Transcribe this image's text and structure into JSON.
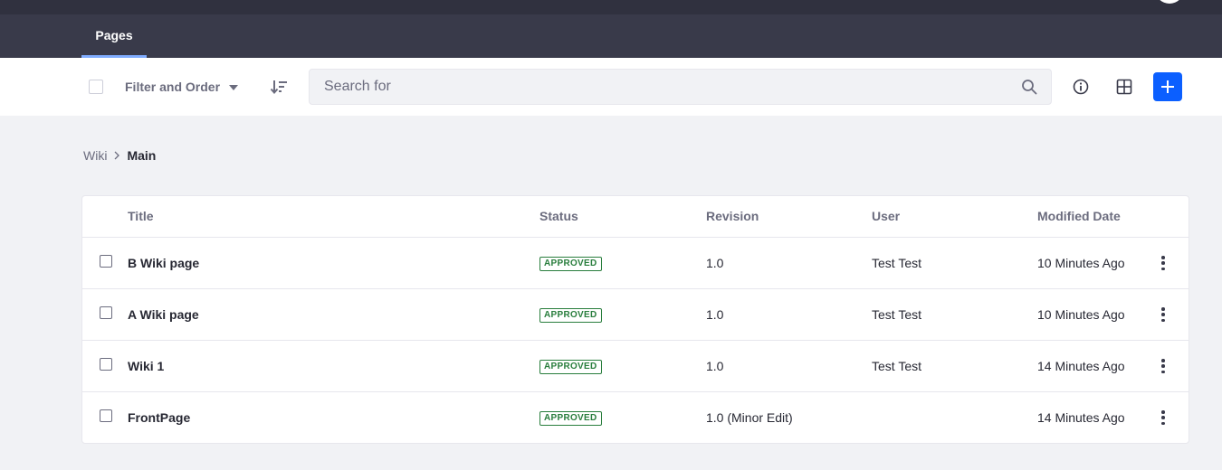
{
  "nav": {
    "tab_label": "Pages"
  },
  "toolbar": {
    "filter_label": "Filter and Order",
    "search_placeholder": "Search for",
    "icons": {
      "order": "sort-order-icon",
      "search": "search-icon",
      "info": "info-icon",
      "view": "grid-view-icon",
      "add": "plus-icon"
    },
    "add_button_color": "#0b5fff"
  },
  "breadcrumb": {
    "parent": "Wiki",
    "current": "Main"
  },
  "table": {
    "columns": {
      "title": "Title",
      "status": "Status",
      "revision": "Revision",
      "user": "User",
      "modified": "Modified Date"
    },
    "rows": [
      {
        "title": "B Wiki page",
        "status": "APPROVED",
        "revision": "1.0",
        "user": "Test Test",
        "modified": "10 Minutes Ago"
      },
      {
        "title": "A Wiki page",
        "status": "APPROVED",
        "revision": "1.0",
        "user": "Test Test",
        "modified": "10 Minutes Ago"
      },
      {
        "title": "Wiki 1",
        "status": "APPROVED",
        "revision": "1.0",
        "user": "Test Test",
        "modified": "14 Minutes Ago"
      },
      {
        "title": "FrontPage",
        "status": "APPROVED",
        "revision": "1.0 (Minor Edit)",
        "user": "",
        "modified": "14 Minutes Ago"
      }
    ]
  },
  "colors": {
    "status_approved": "#287d3c",
    "nav_accent": "#80acff"
  }
}
